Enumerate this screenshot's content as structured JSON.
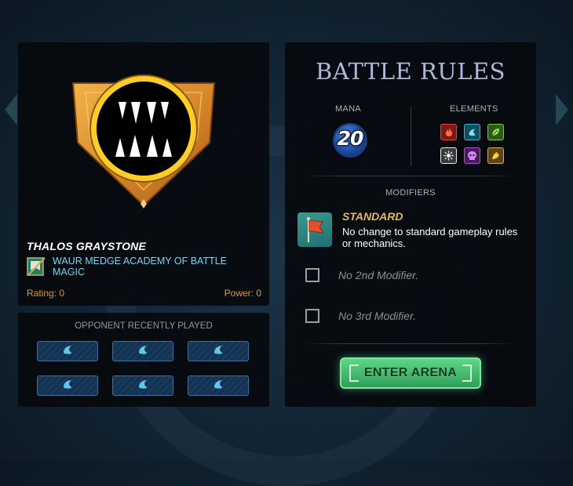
{
  "player": {
    "name": "THALOS GRAYSTONE",
    "guild": "WAUR MEDGE ACADEMY OF BATTLE MAGIC",
    "rating_label": "Rating: 0",
    "power_label": "Power: 0",
    "emblem_icon": "fangs-emblem-icon",
    "guild_icon": "guild-banner-icon"
  },
  "opponent": {
    "title": "OPPONENT RECENTLY PLAYED",
    "slots": [
      "water-splash-icon",
      "water-splash-icon",
      "water-splash-icon",
      "water-splash-icon",
      "water-splash-icon",
      "water-splash-icon"
    ]
  },
  "rules": {
    "title": "BATTLE RULES",
    "mana_label": "MANA",
    "mana_value": "20",
    "elements_label": "ELEMENTS",
    "elements": [
      {
        "name": "fire",
        "color": "#e04a3c"
      },
      {
        "name": "water",
        "color": "#2fb6d6"
      },
      {
        "name": "earth",
        "color": "#6fd13a"
      },
      {
        "name": "life",
        "color": "#e8e8e8"
      },
      {
        "name": "death",
        "color": "#b04ad8"
      },
      {
        "name": "dragon",
        "color": "#e0b030"
      }
    ],
    "modifiers_label": "MODIFIERS",
    "modifier_1": {
      "name": "STANDARD",
      "description": "No change to standard gameplay rules or mechanics."
    },
    "modifier_2": "No 2nd Modifier.",
    "modifier_3": "No 3rd Modifier.",
    "enter_button": "ENTER ARENA"
  }
}
